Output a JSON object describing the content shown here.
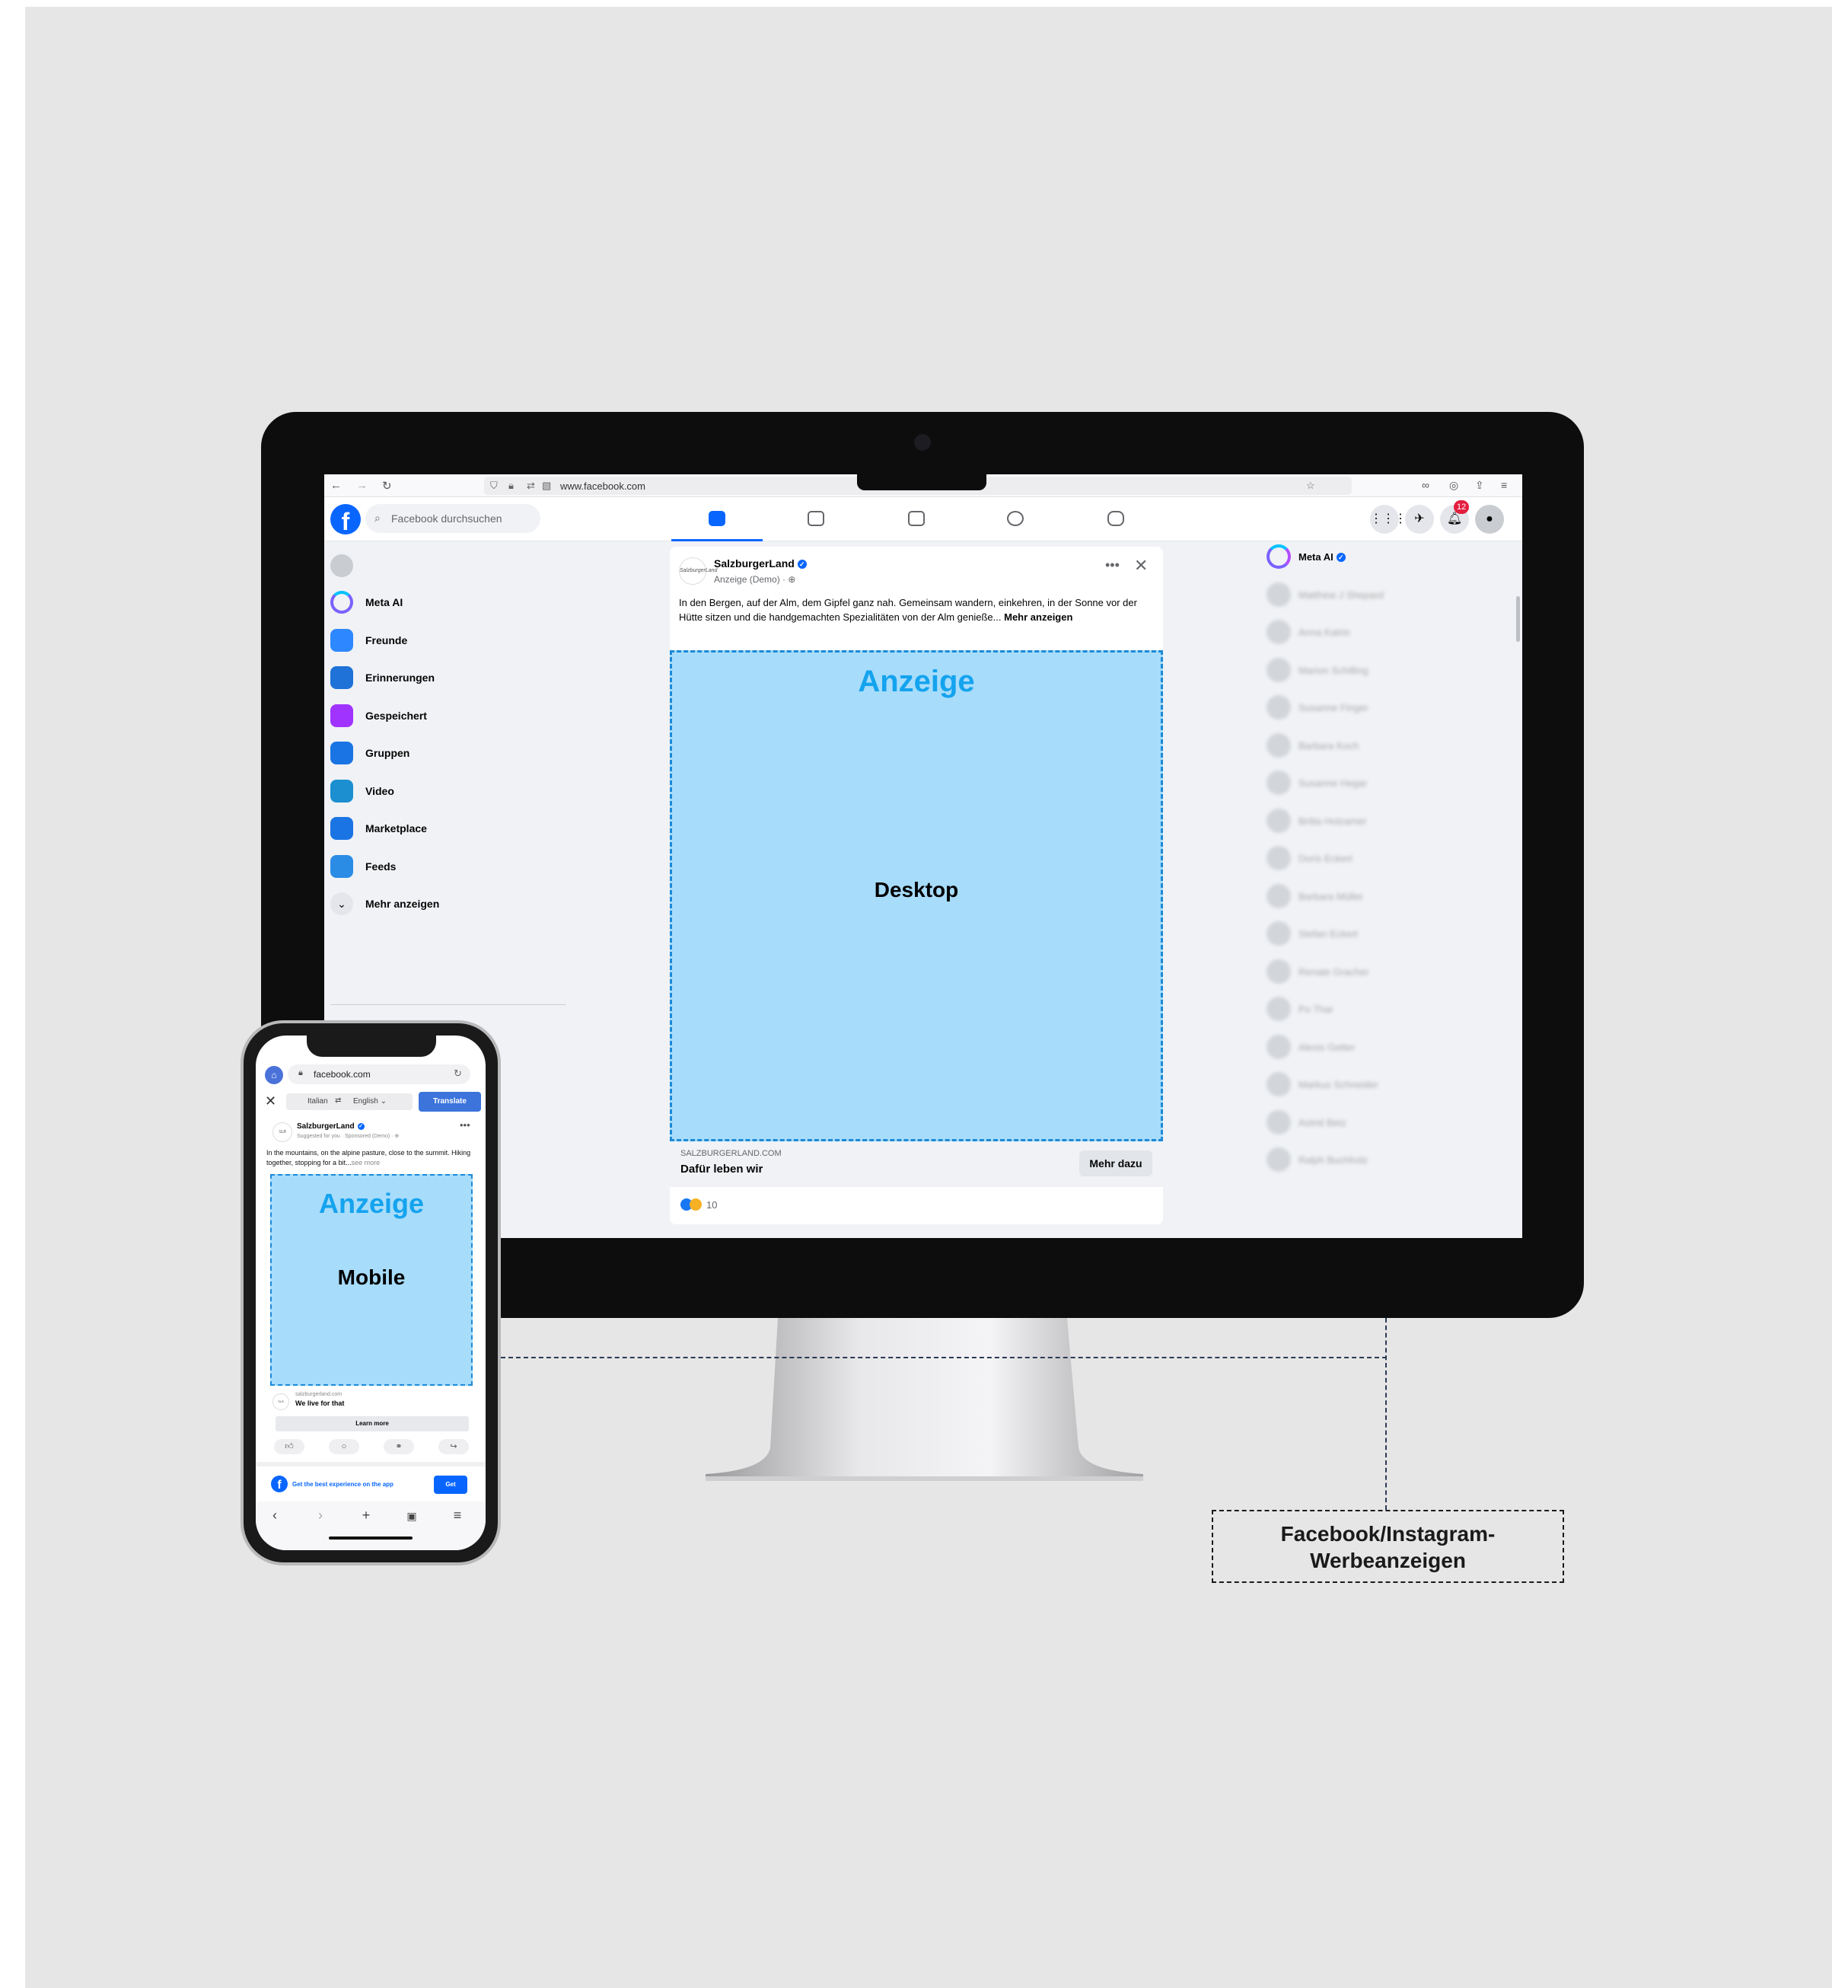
{
  "browser": {
    "url": "www.facebook.com"
  },
  "facebook": {
    "search_placeholder": "Facebook durchsuchen",
    "notification_count": "12",
    "sidebar": [
      {
        "label": "Meta AI",
        "icon": "meta-ai-icon",
        "color": "#7b61ff"
      },
      {
        "label": "Freunde",
        "icon": "friends-icon",
        "color": "#2d88ff"
      },
      {
        "label": "Erinnerungen",
        "icon": "memories-icon",
        "color": "#1e72d8"
      },
      {
        "label": "Gespeichert",
        "icon": "saved-icon",
        "color": "#a033ff"
      },
      {
        "label": "Gruppen",
        "icon": "groups-icon",
        "color": "#1b74e4"
      },
      {
        "label": "Video",
        "icon": "video-icon",
        "color": "#1b8fd0"
      },
      {
        "label": "Marketplace",
        "icon": "marketplace-icon",
        "color": "#1b74e4"
      },
      {
        "label": "Feeds",
        "icon": "feeds-icon",
        "color": "#2b8ce6"
      },
      {
        "label": "Mehr anzeigen",
        "icon": "chevron-down-icon",
        "color": "#e4e6eb"
      }
    ],
    "contacts": {
      "meta_ai_label": "Meta AI",
      "names": [
        "Matthew J Shepard",
        "Anna Katrin",
        "Marion Schilling",
        "Susanne Finger",
        "Barbara Koch",
        "Susanne Hegar",
        "Britta Holzamer",
        "Doris Eckert",
        "Barbara Müller",
        "Stefan Eckert",
        "Renate Gracher",
        "Po Thar",
        "Alexis Getter",
        "Markus Schneider",
        "Astrid Betz",
        "Ralph Buchholz"
      ]
    },
    "post": {
      "page_name": "SalzburgerLand",
      "avatar_text": "SalzburgerLand",
      "subtitle": "Anzeige (Demo) · ⊕",
      "text": "In den Bergen, auf der Alm, dem Gipfel ganz nah. Gemeinsam wandern, einkehren, in der Sonne vor der Hütte sitzen und die handgemachten Spezialitäten von der Alm genieße...",
      "see_more": "Mehr anzeigen",
      "ad_label": "Anzeige",
      "ad_kind": "Desktop",
      "link_domain": "SALZBURGERLAND.COM",
      "link_headline": "Dafür leben wir",
      "cta": "Mehr dazu",
      "reaction_count": "10"
    }
  },
  "phone": {
    "url": "facebook.com",
    "translate_bar": {
      "from": "Italian",
      "arrow": "⇄",
      "to": "English ⌄",
      "button": "Translate"
    },
    "post": {
      "page_name": "SalzburgerLand",
      "subtitle": "Suggested for you · Sponsored (Demo) · ⊕",
      "text": "In the mountains, on the alpine pasture, close to the summit. Hiking together, stopping for a bit...",
      "see_more": "see more",
      "ad_label": "Anzeige",
      "ad_kind": "Mobile",
      "link_domain": "salzburgerland.com",
      "link_headline": "We live for that",
      "cta": "Learn more"
    },
    "app_banner": {
      "text": "Get the best experience on the app",
      "button": "Get"
    }
  },
  "caption": {
    "line1": "Facebook/Instagram-",
    "line2": "Werbeanzeigen"
  },
  "colors": {
    "background": "#e6e6e6",
    "ad_fill": "#a7dcfb",
    "ad_border": "#1c8ad8",
    "ad_label": "#14a3ee",
    "facebook_blue": "#0866ff"
  }
}
